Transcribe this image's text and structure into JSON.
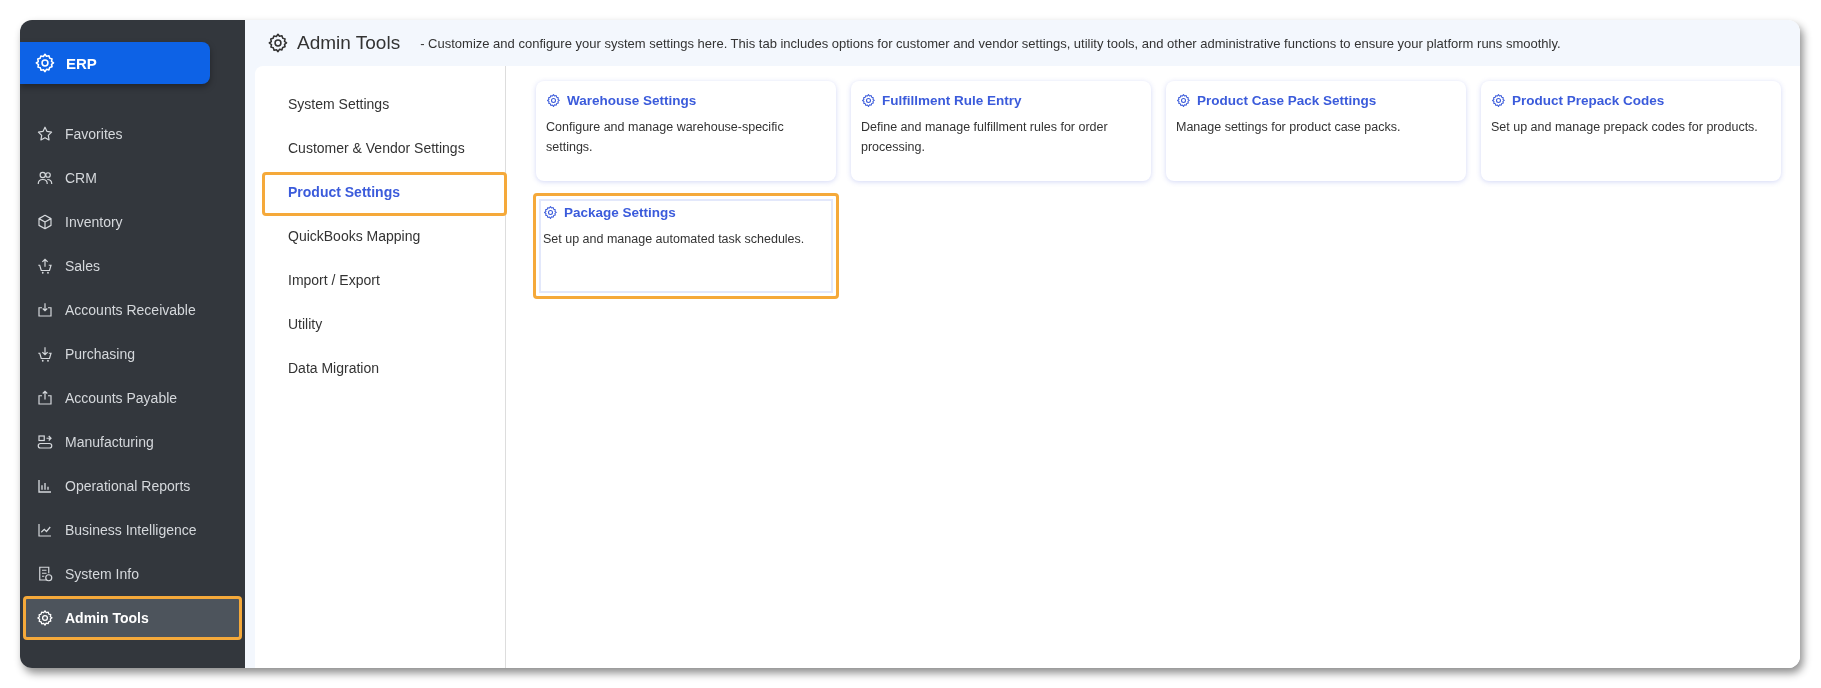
{
  "brand": {
    "label": "ERP"
  },
  "sidebar": {
    "items": [
      {
        "label": "Favorites",
        "selected": false,
        "highlighted": false
      },
      {
        "label": "CRM",
        "selected": false,
        "highlighted": false
      },
      {
        "label": "Inventory",
        "selected": false,
        "highlighted": false
      },
      {
        "label": "Sales",
        "selected": false,
        "highlighted": false
      },
      {
        "label": "Accounts Receivable",
        "selected": false,
        "highlighted": false
      },
      {
        "label": "Purchasing",
        "selected": false,
        "highlighted": false
      },
      {
        "label": "Accounts Payable",
        "selected": false,
        "highlighted": false
      },
      {
        "label": "Manufacturing",
        "selected": false,
        "highlighted": false
      },
      {
        "label": "Operational Reports",
        "selected": false,
        "highlighted": false
      },
      {
        "label": "Business Intelligence",
        "selected": false,
        "highlighted": false
      },
      {
        "label": "System Info",
        "selected": false,
        "highlighted": false
      },
      {
        "label": "Admin Tools",
        "selected": true,
        "highlighted": true
      }
    ]
  },
  "header": {
    "title": "Admin Tools",
    "description": "- Customize and configure your system settings here. This tab includes options for customer and vendor settings, utility tools, and other administrative functions to ensure your platform runs smoothly."
  },
  "menu": {
    "items": [
      {
        "label": "System Settings",
        "selected": false,
        "highlighted": false
      },
      {
        "label": "Customer & Vendor Settings",
        "selected": false,
        "highlighted": false
      },
      {
        "label": "Product Settings",
        "selected": true,
        "highlighted": true
      },
      {
        "label": "QuickBooks Mapping",
        "selected": false,
        "highlighted": false
      },
      {
        "label": "Import / Export",
        "selected": false,
        "highlighted": false
      },
      {
        "label": "Utility",
        "selected": false,
        "highlighted": false
      },
      {
        "label": "Data Migration",
        "selected": false,
        "highlighted": false
      }
    ]
  },
  "cards": [
    {
      "title": "Warehouse Settings",
      "description": "Configure and manage warehouse-specific settings.",
      "highlighted": false
    },
    {
      "title": "Fulfillment Rule Entry",
      "description": "Define and manage fulfillment rules for order processing.",
      "highlighted": false
    },
    {
      "title": "Product Case Pack Settings",
      "description": "Manage settings for product case packs.",
      "highlighted": false
    },
    {
      "title": "Product Prepack Codes",
      "description": "Set up and manage prepack codes for products.",
      "highlighted": false
    },
    {
      "title": "Package Settings",
      "description": "Set up and manage automated task schedules.",
      "highlighted": true
    }
  ]
}
